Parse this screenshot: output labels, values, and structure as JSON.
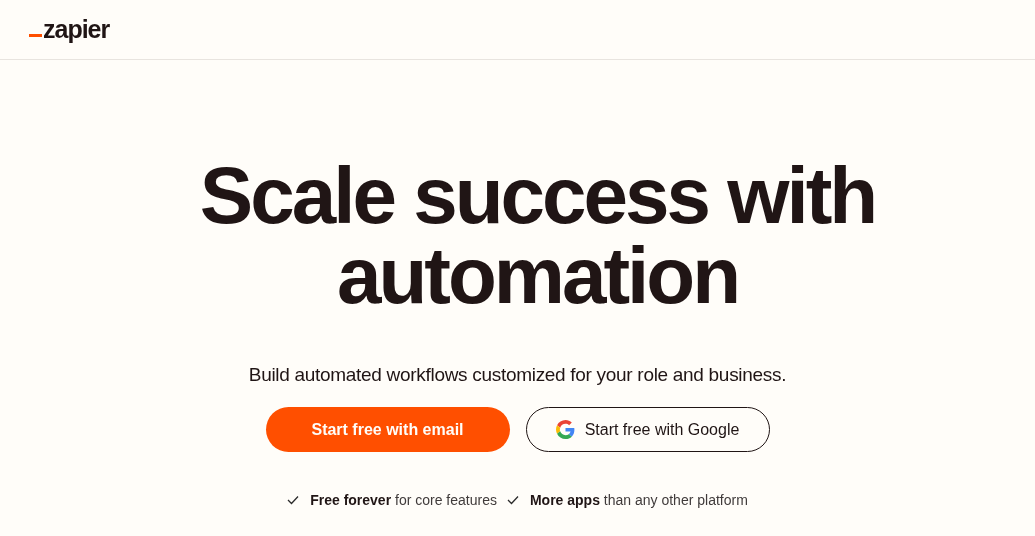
{
  "header": {
    "logo": "zapier"
  },
  "hero": {
    "headline_lines": [
      "Scale success with",
      "automation"
    ],
    "subtitle": "Build automated workflows customized for your role and business.",
    "buttons": [
      {
        "label": "Start free with email",
        "kind": "primary"
      },
      {
        "label": "Start free with Google",
        "kind": "google"
      }
    ],
    "features": [
      "**Free forever** for core features",
      "**More apps** than any other platform"
    ]
  }
}
